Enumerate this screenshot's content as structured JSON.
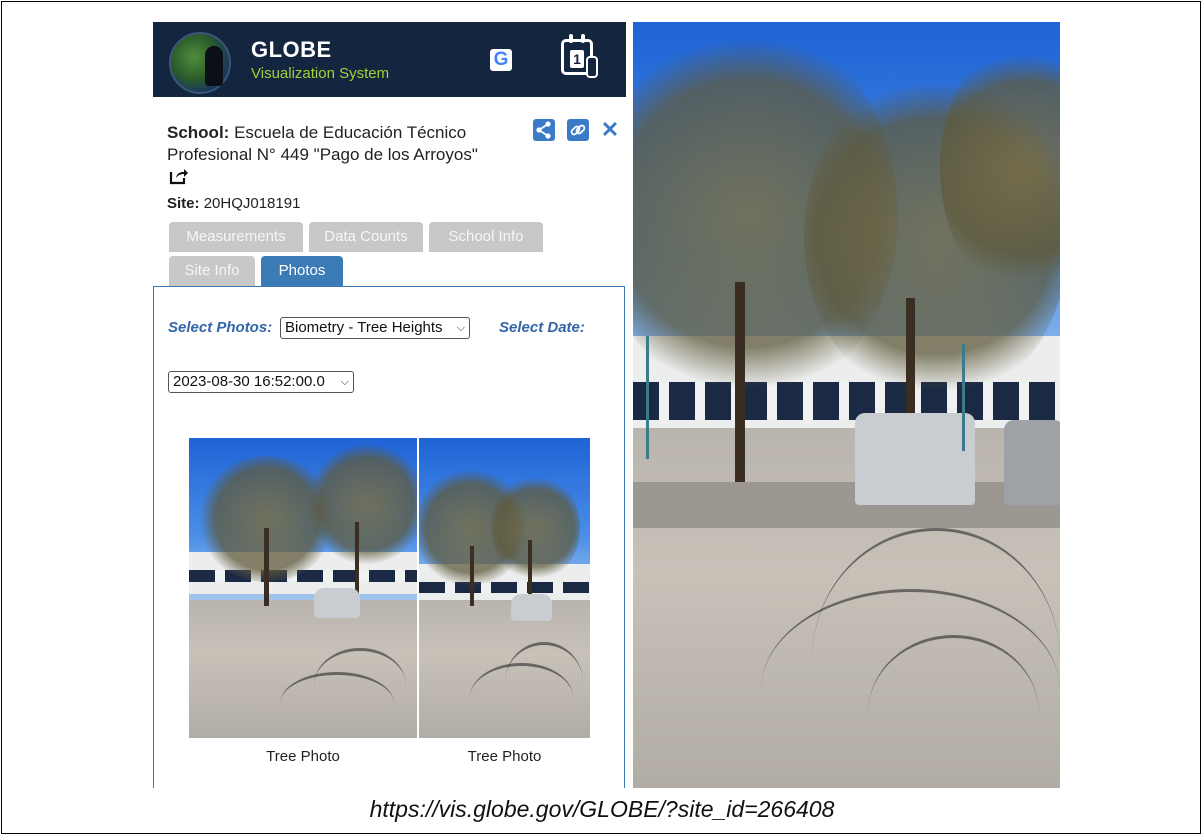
{
  "header": {
    "title": "GLOBE",
    "subtitle": "Visualization System",
    "g_logo": "G",
    "calendar_number": "1",
    "icons": [
      "globe-logo",
      "google-icon",
      "calendar-thermometer-icon"
    ]
  },
  "school": {
    "label": "School:",
    "name": "Escuela de Educación Técnico Profesional N° 449 \"Pago de los Arroyos\""
  },
  "site": {
    "label": "Site:",
    "id": "20HQJ018191"
  },
  "actions": {
    "share_icon": "share-icon",
    "link_icon": "link-icon",
    "close_icon": "close-icon",
    "close_glyph": "✕"
  },
  "tabs": [
    {
      "label": "Measurements",
      "active": false
    },
    {
      "label": "Data Counts",
      "active": false
    },
    {
      "label": "School Info",
      "active": false
    },
    {
      "label": "Site Info",
      "active": false
    },
    {
      "label": "Photos",
      "active": true
    }
  ],
  "photos_panel": {
    "select_photos_label": "Select Photos:",
    "select_photos_value": "Biometry - Tree Heights",
    "select_date_label": "Select Date:",
    "select_date_value": "2023-08-30 16:52:00.0",
    "captions": [
      "Tree Photo",
      "Tree Photo"
    ]
  },
  "url": "https://vis.globe.gov/GLOBE/?site_id=266408",
  "colors": {
    "header_bg": "#14253f",
    "subtitle": "#9ed33a",
    "accent_blue": "#3c7cb6",
    "tab_inactive": "#c8c8c8"
  }
}
